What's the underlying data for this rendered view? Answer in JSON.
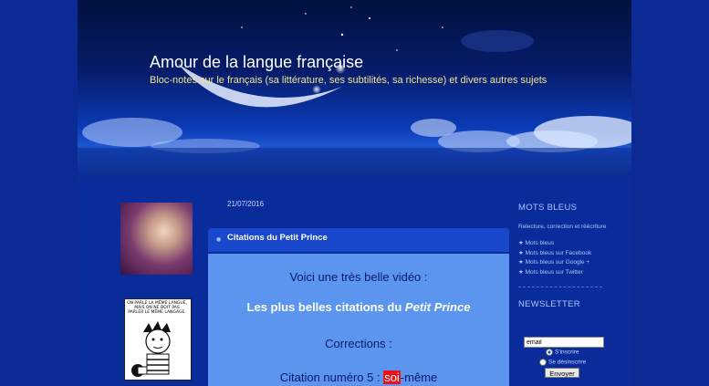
{
  "header": {
    "title": "Amour de la langue française",
    "description": "Bloc-notes sur le français (sa littérature, ses subtilités, sa richesse) et divers autres sujets"
  },
  "sidebar_left": {
    "comic_text": "ON PARLE LA MÊME LANGUE, MAIS ON NE DOIT PAS PARLER LE MÊME LANGAGE."
  },
  "post": {
    "date": "21/07/2016",
    "title": "Citations du Petit Prince",
    "intro": "Voici une très belle vidéo :",
    "headline_prefix": "Les plus belles citations du ",
    "headline_em": "Petit Prince",
    "corrections_label": "Corrections :",
    "citation_prefix": "Citation numéro 5 : ",
    "citation_highlight": "soi",
    "citation_suffix": "-même"
  },
  "sidebar_right": {
    "section1_title": "MOTS BLEUS",
    "section1_text": "Relecture, correction et réécriture",
    "links": [
      "Mots bleus",
      "Mots bleus sur Facebook",
      "Mots bleus sur Google +",
      "Mots bleus sur Twitter"
    ],
    "newsletter_title": "NEWSLETTER",
    "email_value": "email",
    "subscribe_label": "S'inscrire",
    "unsubscribe_label": "Se désinscrire",
    "send_label": "Envoyer"
  },
  "colors": {
    "background": "#0b2a94",
    "post_header": "#1a48cc",
    "post_body": "#5b95f0",
    "highlight": "#e8141a",
    "description_text": "#f2e68c"
  }
}
